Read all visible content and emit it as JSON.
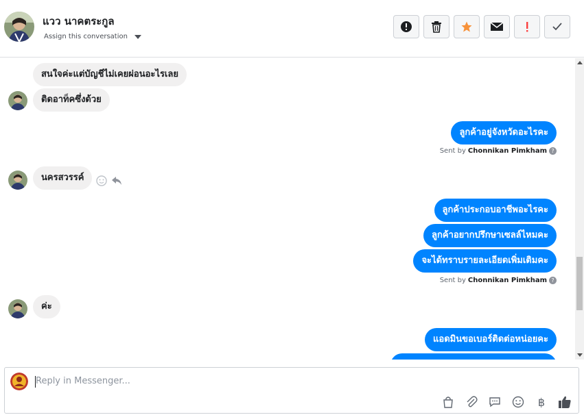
{
  "header": {
    "contact_name": "แวว นาคตระกูล",
    "assign_label": "Assign this conversation"
  },
  "toolbar": {
    "buttons": [
      "alert-icon",
      "trash-icon",
      "star-icon",
      "mail-icon",
      "exclamation-icon",
      "check-icon"
    ],
    "star_color": "#f7923a",
    "exclamation_color": "#fa3e3e"
  },
  "messages": [
    {
      "side": "in",
      "text": "สนใจค่ะแต่บัญชีไม่เคยผ่อนอะไรเลย"
    },
    {
      "side": "in",
      "text": "ติดอาท็คซึ่งด้วย"
    },
    {
      "side": "out",
      "text": "ลูกค้าอยู่จังหวัดอะไรคะ"
    },
    {
      "side": "in",
      "text": "นครสวรรค์"
    },
    {
      "side": "out",
      "text": "ลูกค้าประกอบอาชีพอะไรคะ"
    },
    {
      "side": "out",
      "text": "ลูกค้าอยากปรึกษาเซลล์ไหมคะ"
    },
    {
      "side": "out",
      "text": "จะได้ทราบรายละเอียดเพิ่มเติมคะ"
    },
    {
      "side": "in",
      "text": "ค่ะ"
    },
    {
      "side": "out",
      "text": "แอดมินขอเบอร์ติดต่อหน่อยคะ"
    }
  ],
  "sent_by": {
    "prefix": "Sent by",
    "agent": "Chonnikan Pimkham"
  },
  "composer": {
    "placeholder": "Reply in Messenger...",
    "icons": [
      "shopping-bag-icon",
      "attachment-icon",
      "saved-reply-icon",
      "emoji-icon",
      "baht-icon",
      "thumbs-up-icon"
    ],
    "baht_symbol": "฿"
  },
  "colors": {
    "outgoing_bubble": "#0084ff",
    "incoming_bubble": "#f1f0f0"
  }
}
